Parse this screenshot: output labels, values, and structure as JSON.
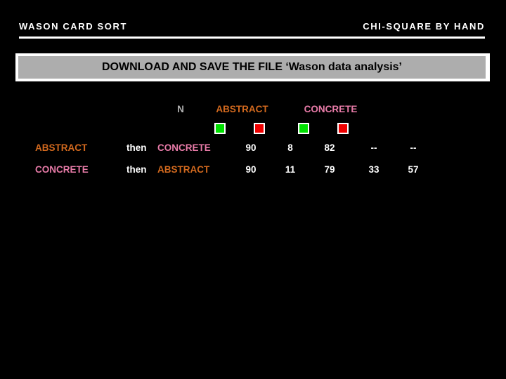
{
  "header": {
    "left_title": "WASON CARD SORT",
    "right_title": "CHI-SQUARE BY HAND"
  },
  "banner": {
    "text": "DOWNLOAD AND SAVE THE FILE ‘Wason data analysis’",
    "background": "#adadad",
    "text_color": "#000000"
  },
  "colors": {
    "abstract": "#d2691e",
    "concrete": "#e87ba8",
    "plain": "#ffffff",
    "gray": "#b3b3b3",
    "green_swatch": "#00e000",
    "red_swatch": "#ee0000"
  },
  "table": {
    "headers": {
      "n": "N",
      "abstract": "ABSTRACT",
      "concrete": "CONCRETE"
    },
    "swatches": [
      {
        "name": "abstract-green",
        "color": "green"
      },
      {
        "name": "abstract-red",
        "color": "red"
      },
      {
        "name": "concrete-green",
        "color": "green"
      },
      {
        "name": "concrete-red",
        "color": "red"
      }
    ],
    "rows": [
      {
        "source": "ABSTRACT",
        "connector": "then",
        "target": "CONCRETE",
        "n": "90",
        "abstract_green": "8",
        "abstract_red": "82",
        "concrete_green": "--",
        "concrete_red": "--"
      },
      {
        "source": "CONCRETE",
        "connector": "then",
        "target": "ABSTRACT",
        "n": "90",
        "abstract_green": "11",
        "abstract_red": "79",
        "concrete_green": "33",
        "concrete_red": "57"
      }
    ]
  }
}
